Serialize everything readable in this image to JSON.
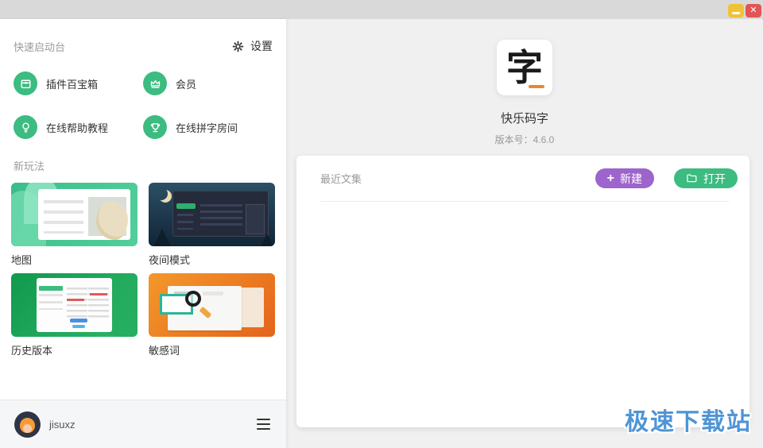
{
  "window": {
    "close_glyph": "✕"
  },
  "sidebar": {
    "title": "快速启动台",
    "settings_label": "设置",
    "quick_items": [
      {
        "label": "插件百宝箱",
        "icon": "treasure-box-icon"
      },
      {
        "label": "会员",
        "icon": "crown-icon"
      },
      {
        "label": "在线帮助教程",
        "icon": "lightbulb-icon"
      },
      {
        "label": "在线拼字房间",
        "icon": "trophy-icon"
      }
    ],
    "section_title": "新玩法",
    "features": [
      {
        "label": "地图"
      },
      {
        "label": "夜间模式"
      },
      {
        "label": "历史版本"
      },
      {
        "label": "敏感词"
      }
    ],
    "user": {
      "name": "jisuxz"
    }
  },
  "main": {
    "app_glyph": "字",
    "app_title": "快乐码字",
    "version": "版本号：4.6.0",
    "recent_title": "最近文集",
    "plus_glyph": "+",
    "new_button": "新建",
    "open_button": "打开"
  },
  "watermark": "极速下载站",
  "colors": {
    "green": "#3cbc80",
    "purple": "#9d64cc",
    "yellow": "#f0c235",
    "red": "#e45454",
    "wblue": "#4f95d6",
    "orange": "#e8882e"
  }
}
